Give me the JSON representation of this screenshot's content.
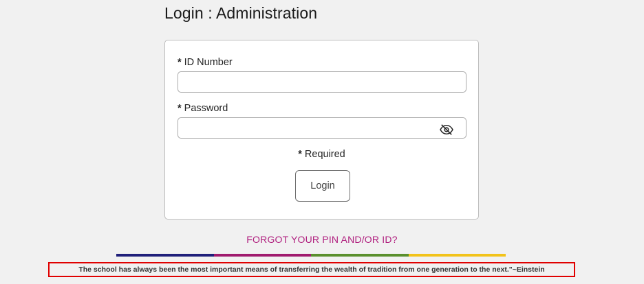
{
  "header": {
    "title": "Login : Administration"
  },
  "form": {
    "required_marker": "*",
    "id_label": "ID Number",
    "id_value": "",
    "id_placeholder": "",
    "password_label": "Password",
    "password_value": "",
    "password_placeholder": "",
    "required_note": "Required",
    "login_label": "Login"
  },
  "links": {
    "forgot": "FORGOT YOUR PIN AND/OR ID?"
  },
  "footer": {
    "quote": "The school has always been the most important means of transferring the wealth of tradition from one generation to the next.\"~Einstein"
  },
  "colors": {
    "forgot_link": "#b0207f",
    "bar_segments": [
      "#1f1f7a",
      "#a01a6e",
      "#5a8f2d",
      "#f2c31a"
    ],
    "quote_border": "#e00000"
  }
}
